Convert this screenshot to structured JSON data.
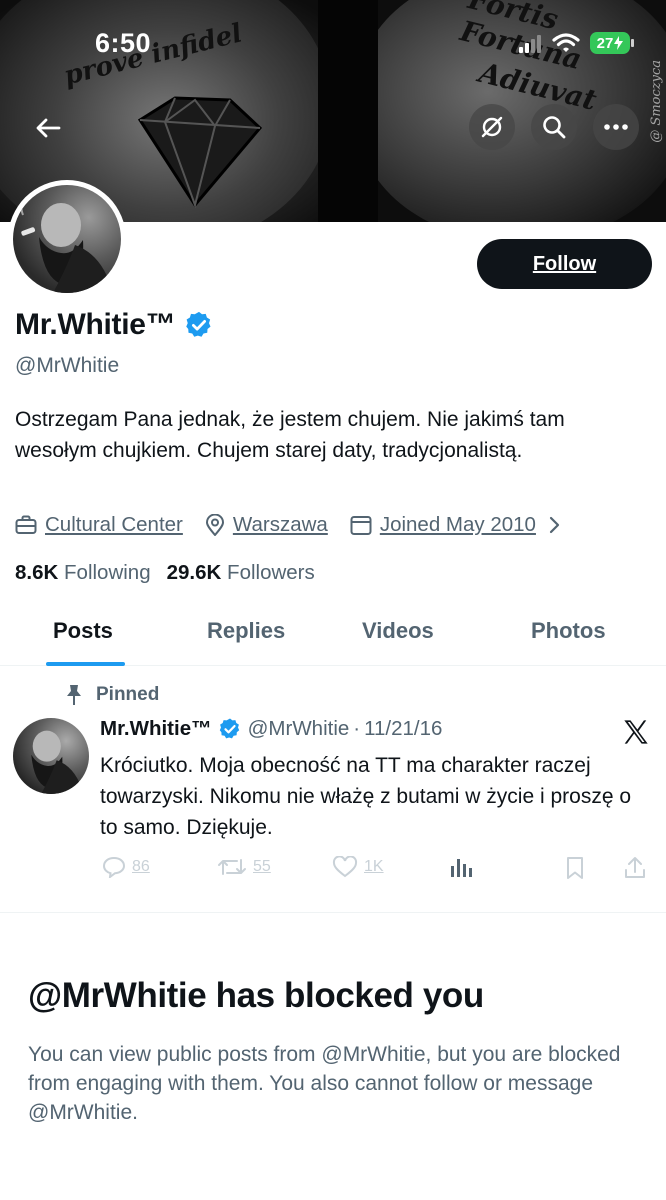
{
  "status_bar": {
    "time": "6:50",
    "battery": "27"
  },
  "banner": {
    "tattoo_left": "prove infidel",
    "tattoo_right_1": "Fortis Fortuna",
    "tattoo_right_2": "Adiuvat",
    "watermark": "@ Smoczyca"
  },
  "profile": {
    "display_name": "Mr.Whitie™",
    "verified": true,
    "handle": "@MrWhitie",
    "follow_label": "Follow",
    "bio": "Ostrzegam Pana jednak, że jestem chujem. Nie jakimś tam wesołym chujkiem. Chujem starej daty, tradycjonalistą.",
    "category": "Cultural Center",
    "location": "Warszawa",
    "joined": "Joined May 2010",
    "following_count": "8.6K",
    "following_label": "Following",
    "followers_count": "29.6K",
    "followers_label": "Followers"
  },
  "tabs": [
    {
      "label": "Posts",
      "active": true
    },
    {
      "label": "Replies",
      "active": false
    },
    {
      "label": "Videos",
      "active": false
    },
    {
      "label": "Photos",
      "active": false
    }
  ],
  "pinned_post": {
    "pinned_label": "Pinned",
    "author": "Mr.Whitie™",
    "handle": "@MrWhitie",
    "separator": "·",
    "date": "11/21/16",
    "text": "Króciutko. Moja obecność na TT ma charakter raczej towarzyski. Nikomu nie włażę z butami w życie i proszę o to samo. Dziękuje.",
    "replies": "86",
    "reposts": "55",
    "likes": "1K"
  },
  "blocked": {
    "title": "@MrWhitie has blocked you",
    "description": "You can view public posts from @MrWhitie, but you are blocked from engaging with them. You also cannot follow or message @MrWhitie."
  },
  "colors": {
    "accent": "#1d9bf0",
    "text": "#0f1419",
    "secondary": "#536471",
    "battery": "#34c759"
  }
}
